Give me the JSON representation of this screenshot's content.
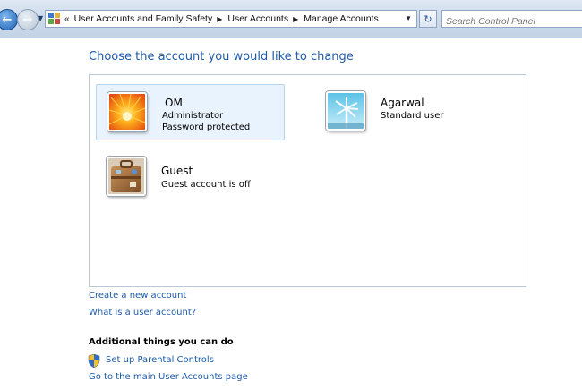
{
  "nav": {
    "back_icon": "back-arrow-icon",
    "forward_icon": "forward-arrow-icon",
    "breadcrumb_prefix": "«",
    "breadcrumbs": [
      "User Accounts and Family Safety",
      "User Accounts",
      "Manage Accounts"
    ],
    "search_placeholder": "Search Control Panel"
  },
  "main": {
    "title": "Choose the account you would like to change",
    "accounts": [
      {
        "name": "OM",
        "lines": [
          "Administrator",
          "Password protected"
        ],
        "picture": "flower-picture",
        "selected": true
      },
      {
        "name": "Agarwal",
        "lines": [
          "Standard user"
        ],
        "picture": "windmill-picture",
        "selected": false
      },
      {
        "name": "Guest",
        "lines": [
          "Guest account is off"
        ],
        "picture": "suitcase-picture",
        "selected": false
      }
    ],
    "links": {
      "create_account": "Create a new account",
      "what_is": "What is a user account?"
    },
    "additional": {
      "heading": "Additional things you can do",
      "parental_controls": "Set up Parental Controls",
      "main_page": "Go to the main User Accounts page"
    }
  },
  "colors": {
    "link": "#1e5aa8",
    "title": "#1e5aa8",
    "selected_tile": "#e9f3fd"
  }
}
